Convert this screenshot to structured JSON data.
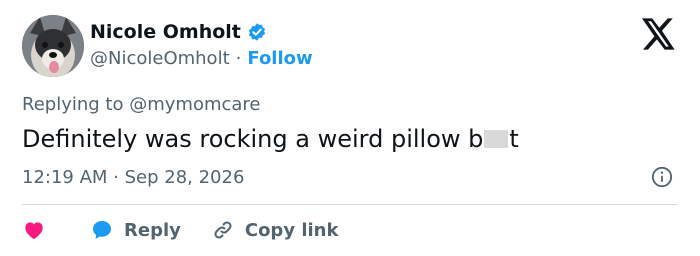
{
  "author": {
    "display_name": "Nicole Omholt",
    "handle": "@NicoleOmholt",
    "separator": "·",
    "follow_label": "Follow",
    "verified_icon": "verified-badge-icon"
  },
  "brand": {
    "logo": "x-logo-icon"
  },
  "reply_context": {
    "prefix": "Replying to",
    "mention": "@mymomcare"
  },
  "tweet": {
    "text_before": "Definitely was rocking a weird pillow b",
    "text_after": "t",
    "timestamp": "12:19 AM · Sep 28, 2026"
  },
  "actions": {
    "like_icon": "heart-icon",
    "reply_label": "Reply",
    "reply_icon": "speech-bubble-icon",
    "copy_label": "Copy link",
    "copy_icon": "link-icon"
  },
  "colors": {
    "accent": "#1d9bf0",
    "like": "#f91880",
    "muted": "#536471",
    "text": "#0f1419"
  }
}
